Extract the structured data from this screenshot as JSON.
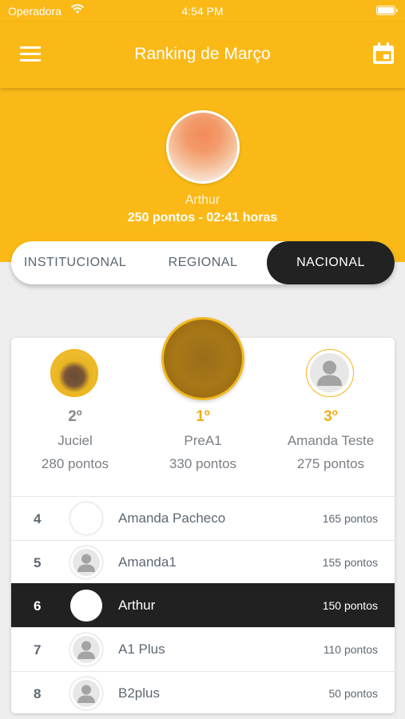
{
  "status_bar": {
    "carrier": "Operadora",
    "time": "4:54 PM"
  },
  "app_bar": {
    "title": "Ranking de Março"
  },
  "profile": {
    "name": "Arthur",
    "stats": "250 pontos - 02:41 horas"
  },
  "tabs": [
    {
      "label": "INSTITUCIONAL",
      "active": false
    },
    {
      "label": "REGIONAL",
      "active": false
    },
    {
      "label": "NACIONAL",
      "active": true
    }
  ],
  "podium": {
    "second": {
      "place": "2º",
      "name": "Juciel",
      "points": "280 pontos"
    },
    "first": {
      "place": "1º",
      "name": "PreA1",
      "points": "330 pontos"
    },
    "third": {
      "place": "3º",
      "name": "Amanda Teste",
      "points": "275 pontos"
    }
  },
  "ranking": [
    {
      "position": "4",
      "name": "Amanda Pacheco",
      "points": "165 pontos",
      "avatar": "blank"
    },
    {
      "position": "5",
      "name": "Amanda1",
      "points": "155 pontos",
      "avatar": "default-person-icon"
    },
    {
      "position": "6",
      "name": "Arthur",
      "points": "150 pontos",
      "avatar": "blank",
      "current_user": true
    },
    {
      "position": "7",
      "name": "A1 Plus",
      "points": "110 pontos",
      "avatar": "default-person-icon"
    },
    {
      "position": "8",
      "name": "B2plus",
      "points": "50 pontos",
      "avatar": "default-person-icon"
    }
  ],
  "colors": {
    "primary": "#fbb917",
    "dark": "#212121",
    "text": "#5d6873",
    "gold": "#f0ad17"
  }
}
